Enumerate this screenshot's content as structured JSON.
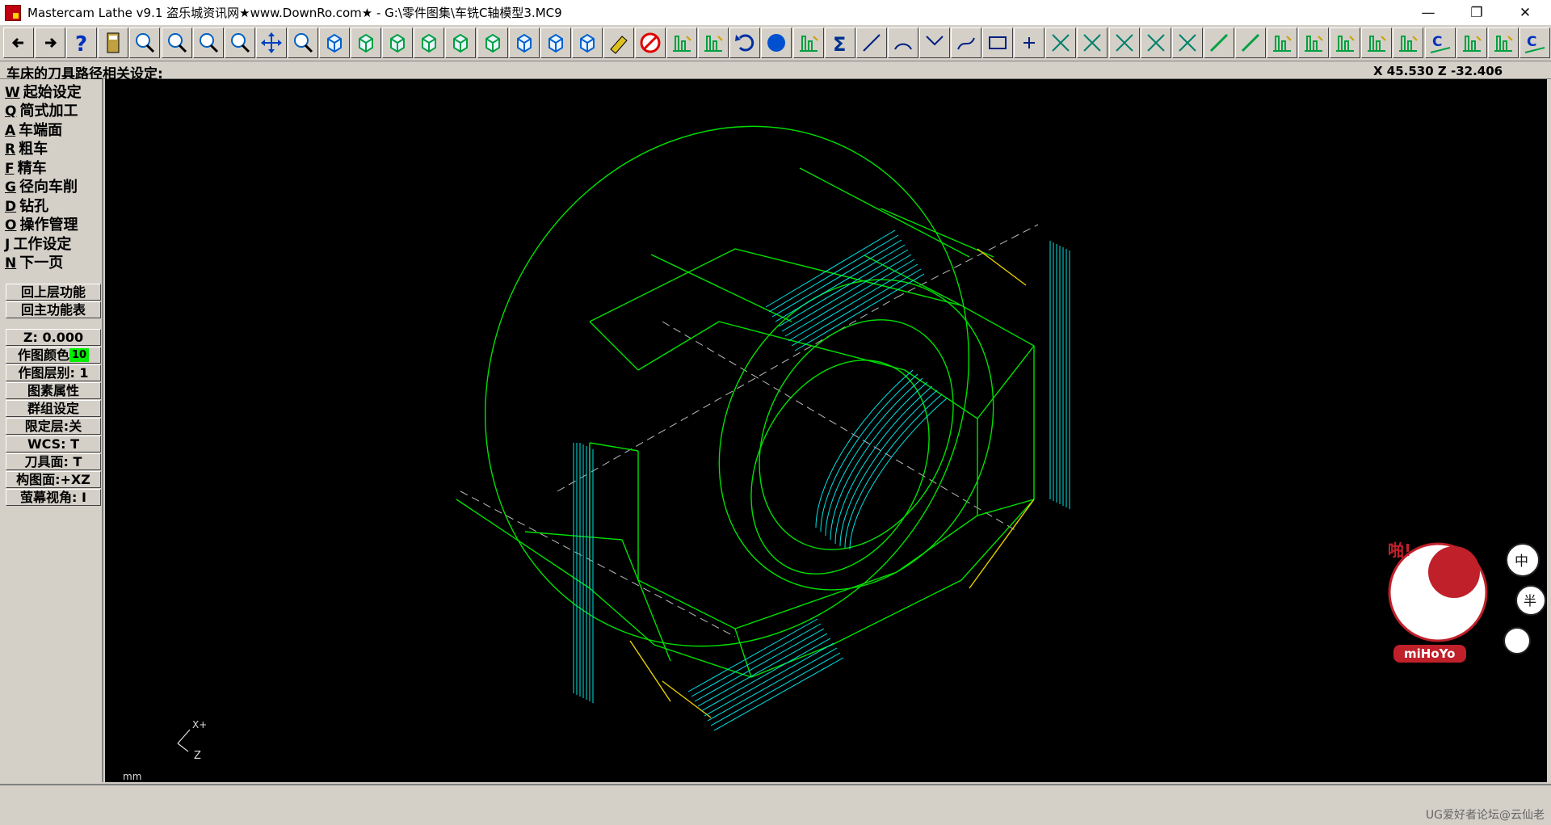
{
  "window": {
    "title": "Mastercam Lathe v9.1 盗乐城资讯网★www.DownRo.com★ - G:\\零件图集\\车铣C轴模型3.MC9",
    "minimize": "—",
    "maximize": "❐",
    "close": "✕"
  },
  "prompt": {
    "text": "车床的刀具路径相关设定:",
    "coords": "X 45.530  Z -32.406"
  },
  "menu": [
    {
      "hotkey": "W",
      "label": "起始设定"
    },
    {
      "hotkey": "Q",
      "label": "简式加工"
    },
    {
      "hotkey": "A",
      "label": "车端面"
    },
    {
      "hotkey": "R",
      "label": "粗车"
    },
    {
      "hotkey": "F",
      "label": "精车"
    },
    {
      "hotkey": "G",
      "label": "径向车削"
    },
    {
      "hotkey": "D",
      "label": "钻孔"
    },
    {
      "hotkey": "O",
      "label": "操作管理"
    },
    {
      "hotkey": "J",
      "label": "工作设定"
    },
    {
      "hotkey": "N",
      "label": "下一页"
    }
  ],
  "nav": {
    "back_upper": "回上层功能",
    "back_main": "回主功能表"
  },
  "status": {
    "z": "Z:   0.000",
    "color_label": "作图颜色",
    "color_value": "10",
    "color_hex": "#00ee00",
    "level": "作图层别:  1",
    "attributes": "图素属性",
    "group": "群组设定",
    "limit_level": "限定层:关",
    "wcs": "WCS:   T",
    "tool_plane": "刀具面:  T",
    "construct_plane": "构图面:+XZ",
    "screen_view": "萤幕视角:  I"
  },
  "viewport": {
    "axis_x": "X+",
    "axis_z": "Z",
    "units": "mm",
    "sticker_text": "miHoYo",
    "sticker_bubbles": [
      "中",
      "半"
    ],
    "sticker_exclaim": "啪!"
  },
  "footer": {
    "watermark": "UG爱好者论坛@云仙老"
  },
  "colors": {
    "geometry": "#00e000",
    "toolpath": "#00e5e5",
    "highlight": "#e8d000",
    "dashed": "#bbbbbb",
    "background": "#000000"
  },
  "toolbar_icons": [
    "back-arrow-icon",
    "forward-arrow-icon",
    "help-icon",
    "calculator-icon",
    "analyze-icon",
    "zoom-window-icon",
    "zoom-in-icon",
    "zoom-previous-icon",
    "pan-icon",
    "select-zoom-icon",
    "rotate-view-icon",
    "view-iso-icon",
    "view-top-icon",
    "view-front-icon",
    "view-side-icon",
    "view-back-icon",
    "view-bottom-icon",
    "view-right-icon",
    "view-left-icon",
    "eraser-icon",
    "no-delete-icon",
    "mirror-icon",
    "translate-icon",
    "undo-icon",
    "shade-icon",
    "transform-icon",
    "sigma-icon",
    "line-icon",
    "arc-icon",
    "fillet-icon",
    "spline-icon",
    "rectangle-icon",
    "point-icon",
    "trim-1-icon",
    "trim-2-icon",
    "trim-3-icon",
    "break-icon",
    "extend-icon",
    "tool-line-icon",
    "chain-icon",
    "level-icon",
    "face-toolpath-icon",
    "rough-toolpath-icon",
    "finish-toolpath-icon",
    "groove-toolpath-icon",
    "c-axis-1-icon",
    "contour-icon",
    "drill-toolpath-icon",
    "c-axis-2-icon"
  ]
}
